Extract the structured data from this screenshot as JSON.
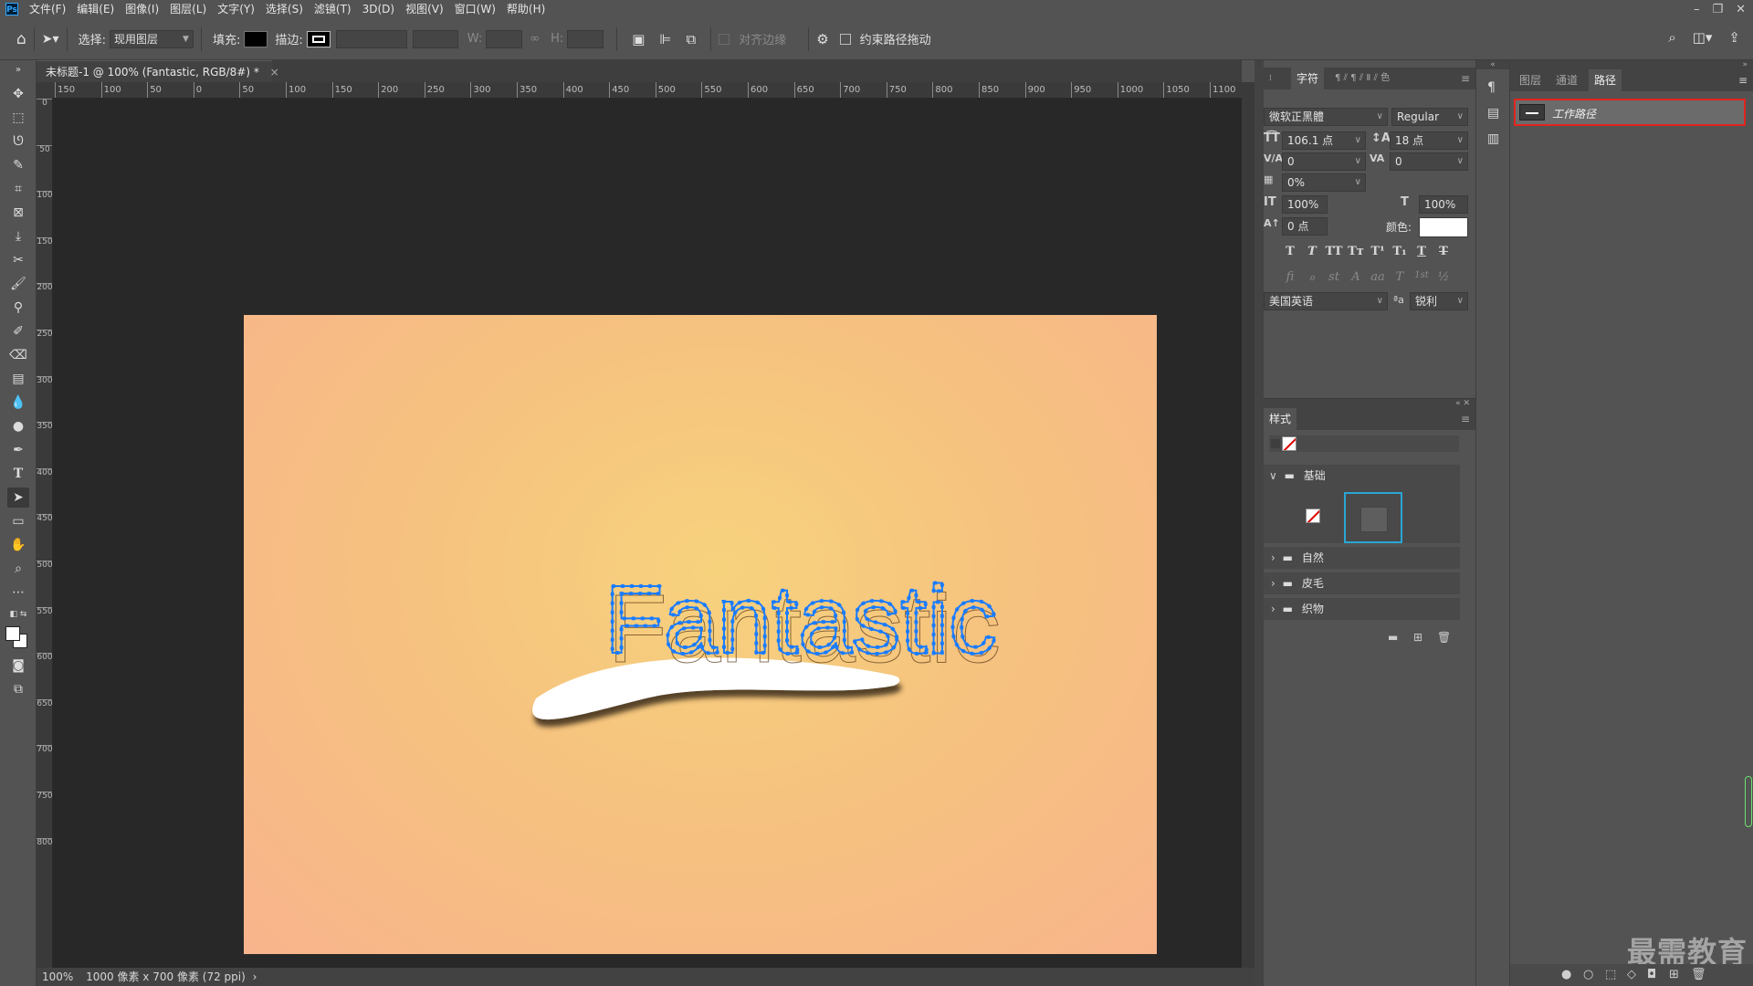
{
  "app": {
    "logo": "Ps"
  },
  "menu": [
    "文件(F)",
    "编辑(E)",
    "图像(I)",
    "图层(L)",
    "文字(Y)",
    "选择(S)",
    "滤镜(T)",
    "3D(D)",
    "视图(V)",
    "窗口(W)",
    "帮助(H)"
  ],
  "options": {
    "select_label": "选择:",
    "select_value": "现用图层",
    "fill_label": "填充:",
    "stroke_label": "描边:",
    "w_label": "W:",
    "h_label": "H:",
    "align_edges_label": "对齐边缘",
    "constrain_label": "约束路径拖动"
  },
  "document": {
    "tab_title": "未标题-1 @ 100% (Fantastic, RGB/8#) *",
    "tab_close": "×",
    "artboard_text": "Fantastic",
    "ruler_h": [
      "150",
      "100",
      "50",
      "0",
      "50",
      "100",
      "150",
      "200",
      "250",
      "300",
      "350",
      "400",
      "450",
      "500",
      "550",
      "600",
      "650",
      "700",
      "750",
      "800",
      "850",
      "900",
      "950",
      "1000",
      "1050",
      "1100"
    ],
    "ruler_v": [
      "0",
      "50",
      "100",
      "150",
      "200",
      "250",
      "300",
      "350",
      "400",
      "450",
      "500",
      "550",
      "600",
      "650",
      "700",
      "750",
      "800"
    ],
    "status_zoom": "100%",
    "status_info": "1000 像素 x 700 像素 (72 ppi)"
  },
  "character": {
    "tab_char": "字符",
    "font_family": "微软正黑體",
    "font_style": "Regular",
    "font_size": "106.1 点",
    "leading": "18 点",
    "kerning": "0",
    "tracking": "0",
    "scale_percent": "0%",
    "vertical_scale": "100%",
    "horizontal_scale": "100%",
    "baseline": "0 点",
    "color_label": "颜色:",
    "language": "美国英语",
    "aa_label": "ªa",
    "antialias": "锐利",
    "format_buttons": [
      "T",
      "T",
      "TT",
      "Tт",
      "T¹",
      "T₁",
      "T",
      "T"
    ],
    "ot_buttons": [
      "fi",
      "ℴ",
      "st",
      "A",
      "aa",
      "T",
      "1st",
      "½"
    ]
  },
  "styles": {
    "tab": "样式",
    "folders": [
      "基础",
      "自然",
      "皮毛",
      "织物"
    ]
  },
  "paths": {
    "tabs": [
      "图层",
      "通道",
      "路径"
    ],
    "work_path": "工作路径"
  },
  "watermark": "最需教育",
  "colors": {
    "accent_selected": "#e0251d",
    "path_blue": "#1a7cff",
    "swatch_blue": "#2aa6d6"
  }
}
